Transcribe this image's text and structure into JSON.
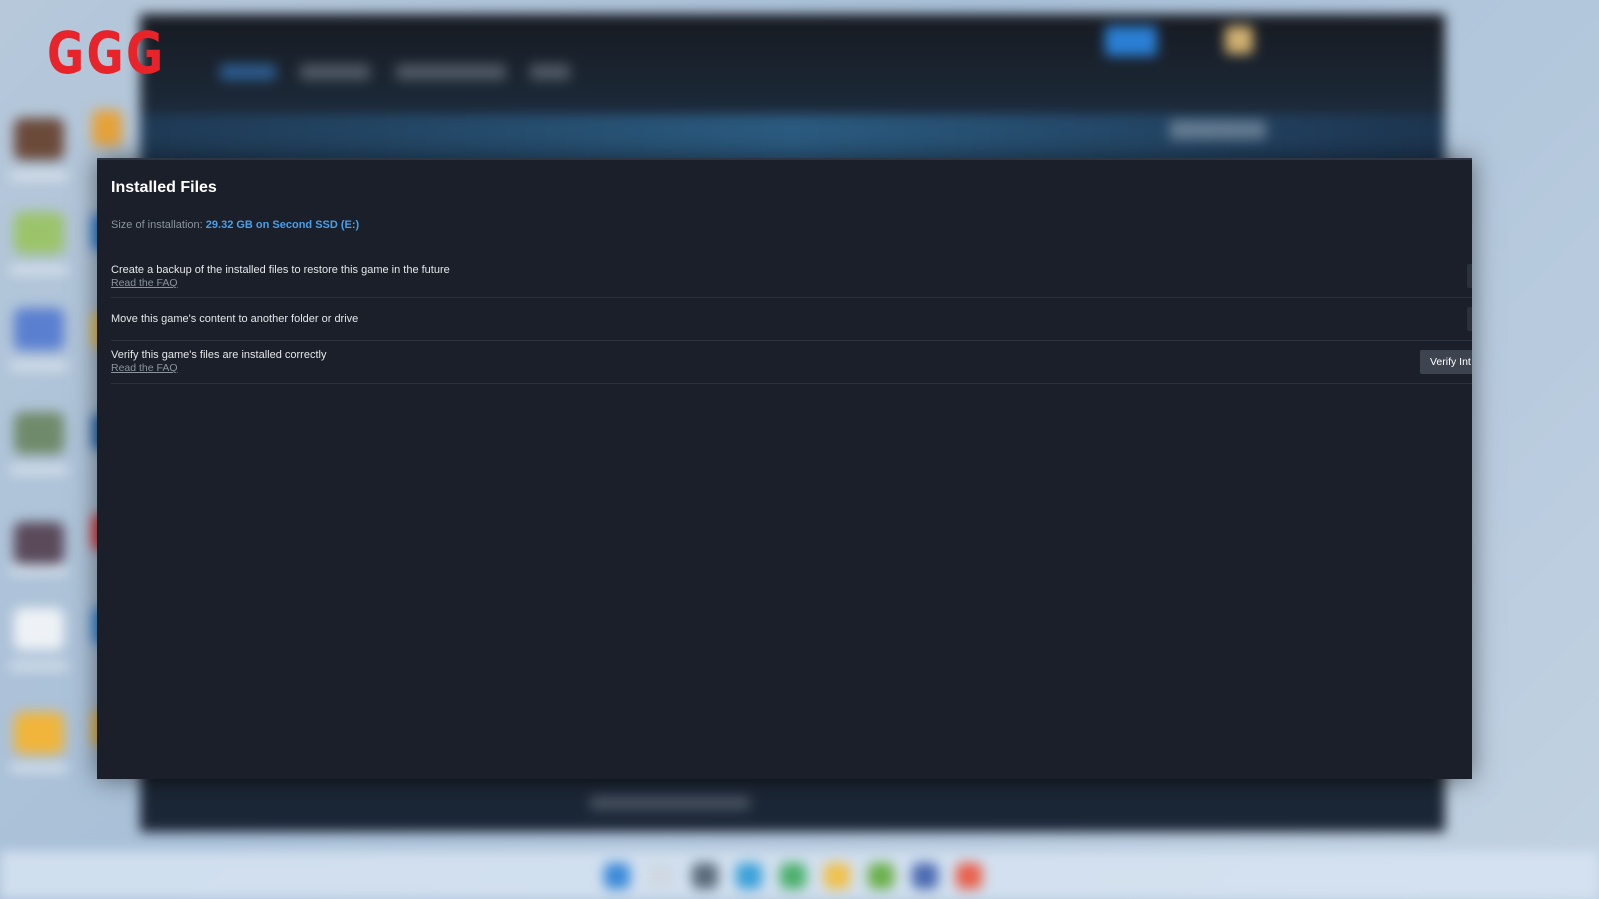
{
  "logo": {
    "text": "GGG",
    "color": "#e8232a"
  },
  "dialog": {
    "title": "Installed Files",
    "size_label": "Size of installation:",
    "size_value": "29.32 GB on Second SSD (E:)",
    "options": [
      {
        "text": "Create a backup of the installed files to restore this game in the future",
        "link": "Read the FAQ"
      },
      {
        "text": "Move this game's content to another folder or drive"
      },
      {
        "text": "Verify this game's files are installed correctly",
        "link": "Read the FAQ",
        "button": "Verify Int"
      }
    ]
  },
  "colors": {
    "dialog_bg": "#1a1f2a",
    "accent": "#4a9fe8",
    "logo_red": "#e8232a"
  }
}
